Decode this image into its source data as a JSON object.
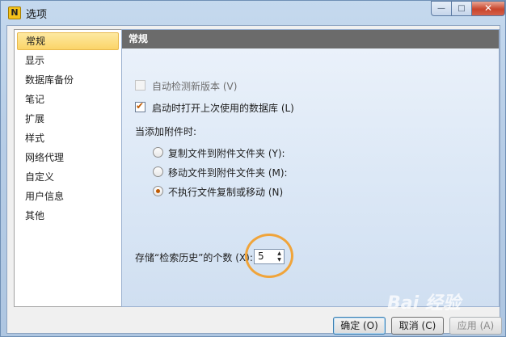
{
  "window": {
    "title": "选项",
    "app_icon_letter": "N"
  },
  "caption_buttons": {
    "minimize": "—",
    "maximize": "□",
    "close": "✕"
  },
  "nav": {
    "items": [
      "常规",
      "显示",
      "数据库备份",
      "笔记",
      "扩展",
      "样式",
      "网络代理",
      "自定义",
      "用户信息",
      "其他"
    ],
    "selected": "常规"
  },
  "panel": {
    "title": "常规",
    "auto_update": {
      "label": "自动检测新版本 (V)",
      "checked": false
    },
    "open_last_db": {
      "label": "启动时打开上次使用的数据库 (L)",
      "checked": true
    },
    "attachment_heading": "当添加附件时:",
    "attachment_options": [
      {
        "label": "复制文件到附件文件夹 (Y):",
        "selected": false
      },
      {
        "label": "移动文件到附件文件夹 (M):",
        "selected": false
      },
      {
        "label": "不执行文件复制或移动 (N)",
        "selected": true
      }
    ],
    "history_label": "存储“检索历史”的个数 (X):",
    "history_count": "5"
  },
  "buttons": {
    "ok": "确定 (O)",
    "cancel": "取消 (C)",
    "apply": "应用 (A)"
  },
  "watermark": "Bai 经验"
}
